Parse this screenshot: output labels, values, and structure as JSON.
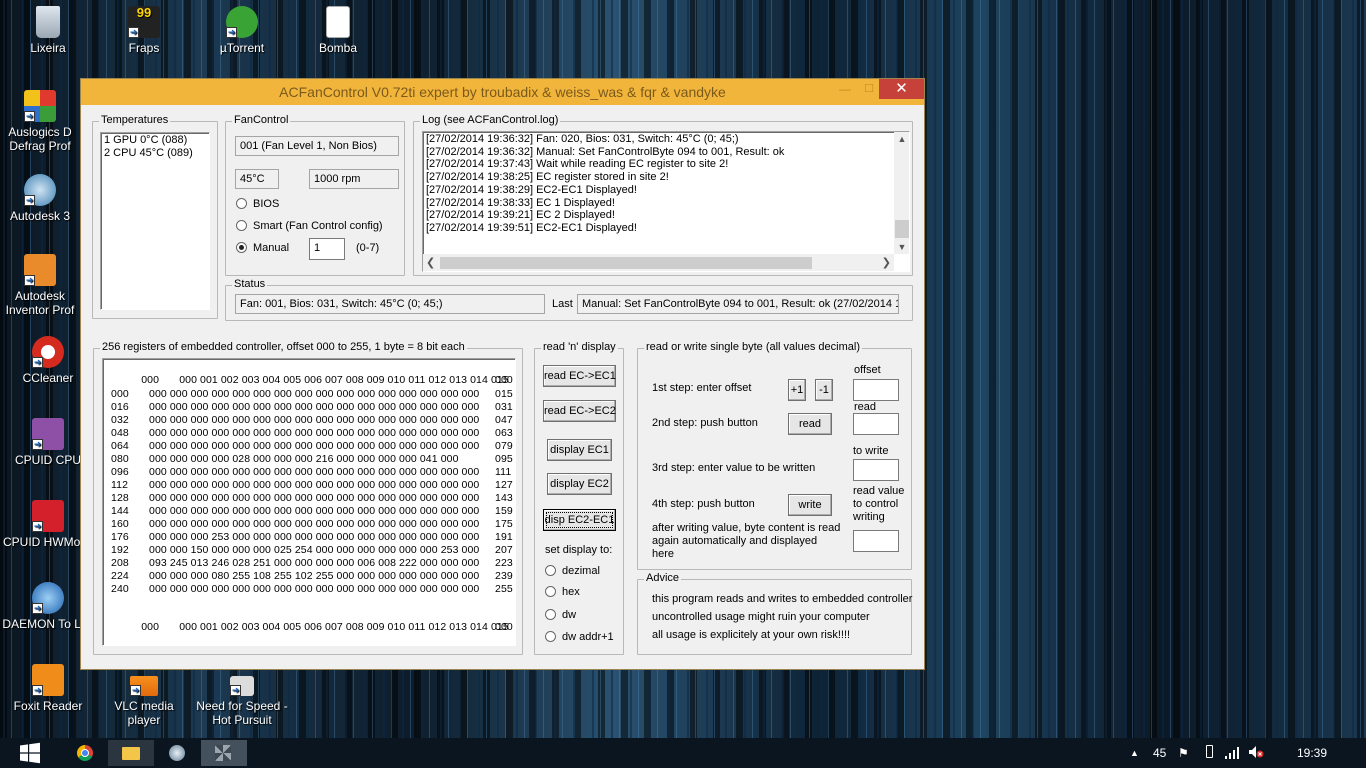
{
  "desktop": {
    "icons": [
      {
        "id": "lixeira",
        "label": "Lixeira"
      },
      {
        "id": "fraps",
        "label": "Fraps",
        "badge": "99"
      },
      {
        "id": "utorrent",
        "label": "µTorrent"
      },
      {
        "id": "bomba",
        "label": "Bomba"
      },
      {
        "id": "auslogics",
        "label": "Auslogics D Defrag Prof"
      },
      {
        "id": "autodesk3",
        "label": "Autodesk 3"
      },
      {
        "id": "inventor",
        "label": "Autodesk Inventor Prof"
      },
      {
        "id": "ccleaner",
        "label": "CCleaner"
      },
      {
        "id": "cpuidcpu",
        "label": "CPUID CPU"
      },
      {
        "id": "hwmonitor",
        "label": "CPUID HWMonit"
      },
      {
        "id": "daemon",
        "label": "DAEMON To Lite"
      },
      {
        "id": "foxit",
        "label": "Foxit Reader"
      },
      {
        "id": "vlc",
        "label": "VLC media player"
      },
      {
        "id": "nfs",
        "label": "Need for Speed - Hot Pursuit"
      }
    ]
  },
  "window": {
    "title": "ACFanControl  V0.72ti expert by troubadix & weiss_was & fqr & vandyke",
    "close_glyph": "✕",
    "min_glyph": "—",
    "max_glyph": "☐"
  },
  "temperatures": {
    "legend": "Temperatures",
    "items": [
      "1 GPU 0°C (088)",
      "2 CPU 45°C (089)"
    ]
  },
  "fancontrol": {
    "legend": "FanControl",
    "level": "001 (Fan Level 1, Non Bios)",
    "temp": "45°C",
    "rpm": "1000 rpm",
    "bios_label": "BIOS",
    "smart_label": "Smart (Fan Control config)",
    "manual_label": "Manual",
    "manual_value": "1",
    "range_label": "(0-7)",
    "selected": "manual"
  },
  "log": {
    "legend": "Log (see ACFanControl.log)",
    "lines": [
      "[27/02/2014 19:36:32] Fan: 020, Bios: 031, Switch: 45°C (0; 45;)",
      "[27/02/2014 19:36:32] Manual: Set FanControlByte 094 to 001, Result: ok",
      "[27/02/2014 19:37:43] Wait while reading EC register to site 2!",
      "[27/02/2014 19:38:25] EC register stored in site 2!",
      "[27/02/2014 19:38:29] EC2-EC1 Displayed!",
      "[27/02/2014 19:38:33] EC 1 Displayed!",
      "[27/02/2014 19:39:21] EC 2 Displayed!",
      "[27/02/2014 19:39:51] EC2-EC1 Displayed!"
    ]
  },
  "status": {
    "legend": "Status",
    "value": "Fan: 001, Bios: 031, Switch: 45°C (0; 45;)",
    "last_label": "Last",
    "last_value": "Manual: Set FanControlByte 094 to 001, Result: ok    (27/02/2014 1"
  },
  "registers": {
    "legend": "256 registers of embedded controller, offset 000 to 255, 1 byte = 8 bit each",
    "header_left": "000",
    "header_cols": "000 001 002 003 004 005 006 007 008 009 010 011 012 013 014 015",
    "header_right": "000",
    "rows": [
      {
        "addr": "000",
        "bytes": "000 000 000 000 000 000 000 000 000 000 000 000 000 000 000 000",
        "end": "015"
      },
      {
        "addr": "016",
        "bytes": "000 000 000 000 000 000 000 000 000 000 000 000 000 000 000 000",
        "end": "031"
      },
      {
        "addr": "032",
        "bytes": "000 000 000 000 000 000 000 000 000 000 000 000 000 000 000 000",
        "end": "047"
      },
      {
        "addr": "048",
        "bytes": "000 000 000 000 000 000 000 000 000 000 000 000 000 000 000 000",
        "end": "063"
      },
      {
        "addr": "064",
        "bytes": "000 000 000 000 000 000 000 000 000 000 000 000 000 000 000 000",
        "end": "079"
      },
      {
        "addr": "080",
        "bytes": "000 000 000 000 028 000 000 000 216 000 000 000 000 041 000",
        "end": "095"
      },
      {
        "addr": "096",
        "bytes": "000 000 000 000 000 000 000 000 000 000 000 000 000 000 000 000",
        "end": "111"
      },
      {
        "addr": "112",
        "bytes": "000 000 000 000 000 000 000 000 000 000 000 000 000 000 000 000",
        "end": "127"
      },
      {
        "addr": "128",
        "bytes": "000 000 000 000 000 000 000 000 000 000 000 000 000 000 000 000",
        "end": "143"
      },
      {
        "addr": "144",
        "bytes": "000 000 000 000 000 000 000 000 000 000 000 000 000 000 000 000",
        "end": "159"
      },
      {
        "addr": "160",
        "bytes": "000 000 000 000 000 000 000 000 000 000 000 000 000 000 000 000",
        "end": "175"
      },
      {
        "addr": "176",
        "bytes": "000 000 000 253 000 000 000 000 000 000 000 000 000 000 000 000",
        "end": "191"
      },
      {
        "addr": "192",
        "bytes": "000 000 150 000 000 000 025 254 000 000 000 000 000 000 253 000",
        "end": "207"
      },
      {
        "addr": "208",
        "bytes": "093 245 013 246 028 251 000 000 000 000 006 008 222 000 000 000",
        "end": "223"
      },
      {
        "addr": "224",
        "bytes": "000 000 000 080 255 108 255 102 255 000 000 000 000 000 000 000",
        "end": "239"
      },
      {
        "addr": "240",
        "bytes": "000 000 000 000 000 000 000 000 000 000 000 000 000 000 000 000",
        "end": "255"
      }
    ],
    "footer_left": "000",
    "footer_cols": "000 001 002 003 004 005 006 007 008 009 010 011 012 013 014 015",
    "footer_right": "000"
  },
  "display": {
    "legend": "read 'n' display",
    "read_ec1": "read EC->EC1",
    "read_ec2": "read EC->EC2",
    "display_ec1": "display EC1",
    "display_ec2": "display EC2",
    "disp_diff": "disp EC2-EC1",
    "set_display_label": "set display to:",
    "options": [
      "dezimal",
      "hex",
      "dw",
      "dw addr+1"
    ]
  },
  "single_byte": {
    "legend": "read or write single byte (all values decimal)",
    "step1": "1st step: enter offset",
    "plus": "+1",
    "minus": "-1",
    "offset_label": "offset",
    "step2": "2nd step: push button",
    "read_btn": "read",
    "read_label": "read",
    "to_write_label": "to write",
    "step3": "3rd step: enter value to be written",
    "step4": "4th step: push button",
    "write_btn": "write",
    "read_value_label": "read value to control writing",
    "after_note": "after writing value, byte content is read again automatically and displayed here"
  },
  "advice": {
    "legend": "Advice",
    "lines": [
      "this program reads and writes to embedded controller",
      "uncontrolled usage might ruin your computer",
      "all usage is explicitely at your own risk!!!!"
    ]
  },
  "taskbar": {
    "tray_number": "45",
    "clock": "19:39"
  },
  "colors": {
    "titlebar": "#f2b53b",
    "close": "#c7413b",
    "window_bg": "#f0f0f0"
  }
}
